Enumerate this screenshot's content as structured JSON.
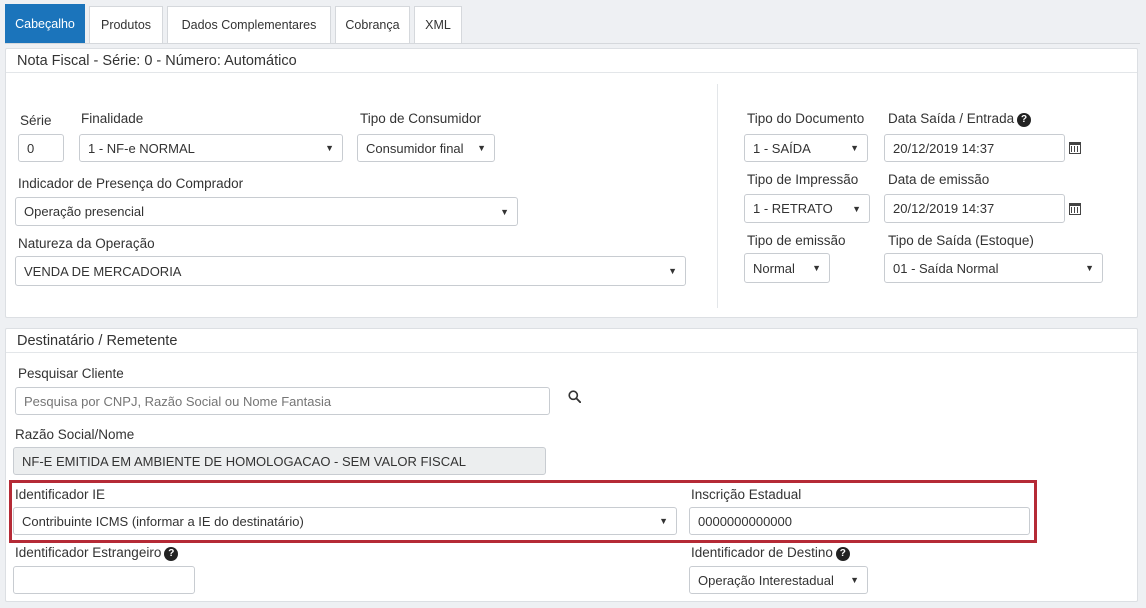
{
  "tabs": [
    "Cabeçalho",
    "Produtos",
    "Dados Complementares",
    "Cobrança",
    "XML"
  ],
  "nota": {
    "title": "Nota Fiscal - Série: 0 - Número: Automático",
    "serie_label": "Série",
    "serie_value": "0",
    "finalidade_label": "Finalidade",
    "finalidade_value": "1 - NF-e NORMAL",
    "tipo_consumidor_label": "Tipo de Consumidor",
    "tipo_consumidor_value": "Consumidor final",
    "presenca_label": "Indicador de Presença do Comprador",
    "presenca_value": "Operação presencial",
    "natureza_label": "Natureza da Operação",
    "natureza_value": "VENDA DE MERCADORIA",
    "tipo_documento_label": "Tipo do Documento",
    "tipo_documento_value": "1 - SAÍDA",
    "data_saida_label": "Data Saída / Entrada",
    "data_saida_value": "20/12/2019 14:37",
    "tipo_impressao_label": "Tipo de Impressão",
    "tipo_impressao_value": "1 - RETRATO",
    "data_emissao_label": "Data de emissão",
    "data_emissao_value": "20/12/2019 14:37",
    "tipo_emissao_label": "Tipo de emissão",
    "tipo_emissao_value": "Normal",
    "tipo_saida_label": "Tipo de Saída (Estoque)",
    "tipo_saida_value": "01 - Saída Normal"
  },
  "dest": {
    "title": "Destinatário / Remetente",
    "pesquisar_label": "Pesquisar Cliente",
    "pesquisar_placeholder": "Pesquisa por CNPJ, Razão Social ou Nome Fantasia",
    "razao_label": "Razão Social/Nome",
    "razao_value": "NF-E EMITIDA EM AMBIENTE DE HOMOLOGACAO - SEM VALOR FISCAL",
    "ie_id_label": "Identificador IE",
    "ie_id_value": "Contribuinte ICMS (informar a IE do destinatário)",
    "inscricao_label": "Inscrição Estadual",
    "inscricao_value": "0000000000000",
    "estrangeiro_label": "Identificador Estrangeiro",
    "estrangeiro_value": "",
    "destino_label": "Identificador de Destino",
    "destino_value": "Operação Interestadual"
  },
  "icons": {
    "help": "question-circle-icon",
    "calendar": "calendar-icon",
    "search": "search-icon"
  },
  "colors": {
    "tab_active": "#1b74bb",
    "highlight": "#b52a36"
  }
}
